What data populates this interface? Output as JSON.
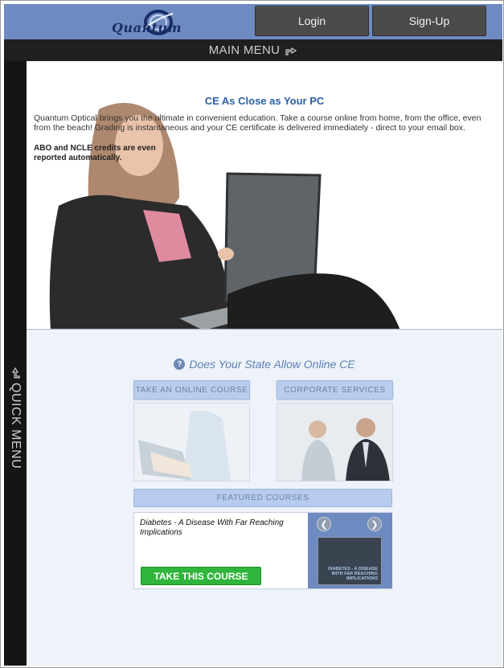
{
  "header": {
    "logo_text": "Quantum",
    "login_label": "Login",
    "signup_label": "Sign-Up"
  },
  "main_menu": {
    "label": "MAIN MENU",
    "icon": "hand-pointer-icon"
  },
  "quick_menu": {
    "label": "QUICK MENU",
    "icon": "hand-pointer-icon"
  },
  "hero": {
    "title": "CE As Close as Your PC",
    "body": "Quantum Optical brings you the ultimate in convenient education. Take a course online from home, from the office, even from the beach! Grading is instantaneous and your CE certificate is delivered immediately - direct to your email box.",
    "note": "ABO and NCLE credits are even reported automatically."
  },
  "state_question": {
    "text": "Does Your State Allow Online CE",
    "icon": "question-circle-icon"
  },
  "tiles": {
    "online_course": "TAKE AN ONLINE COURSE",
    "corporate": "CORPORATE SERVICES"
  },
  "featured": {
    "header": "FEATURED COURSES",
    "course_title": "Diabetes - A Disease With Far Reaching Implications",
    "button_label": "TAKE THIS COURSE",
    "thumb_text": "DIABETES - A DISEASE WITH FAR REACHING IMPLICATIONS"
  },
  "colors": {
    "header_bg": "#6e8bc1",
    "menu_bar": "#1f1f1f",
    "accent_title": "#2d5fa6",
    "button_green": "#2fb53b",
    "tile_head": "#b9cdee"
  }
}
